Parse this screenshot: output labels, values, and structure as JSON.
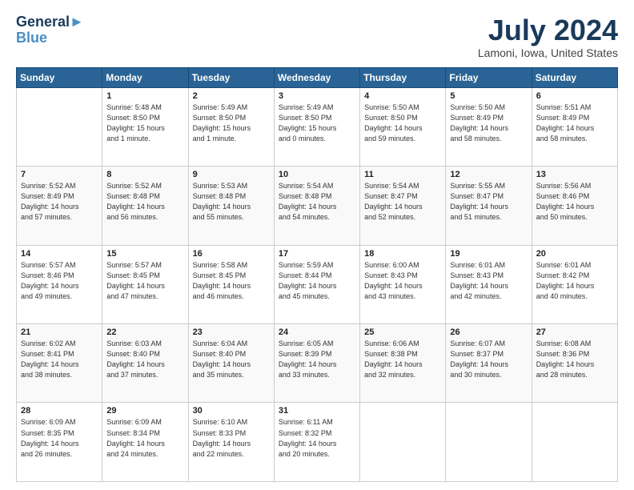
{
  "header": {
    "logo_line1": "General",
    "logo_line2": "Blue",
    "month": "July 2024",
    "location": "Lamoni, Iowa, United States"
  },
  "weekdays": [
    "Sunday",
    "Monday",
    "Tuesday",
    "Wednesday",
    "Thursday",
    "Friday",
    "Saturday"
  ],
  "weeks": [
    [
      {
        "day": "",
        "sunrise": "",
        "sunset": "",
        "daylight": ""
      },
      {
        "day": "1",
        "sunrise": "Sunrise: 5:48 AM",
        "sunset": "Sunset: 8:50 PM",
        "daylight": "Daylight: 15 hours and 1 minute."
      },
      {
        "day": "2",
        "sunrise": "Sunrise: 5:49 AM",
        "sunset": "Sunset: 8:50 PM",
        "daylight": "Daylight: 15 hours and 1 minute."
      },
      {
        "day": "3",
        "sunrise": "Sunrise: 5:49 AM",
        "sunset": "Sunset: 8:50 PM",
        "daylight": "Daylight: 15 hours and 0 minutes."
      },
      {
        "day": "4",
        "sunrise": "Sunrise: 5:50 AM",
        "sunset": "Sunset: 8:50 PM",
        "daylight": "Daylight: 14 hours and 59 minutes."
      },
      {
        "day": "5",
        "sunrise": "Sunrise: 5:50 AM",
        "sunset": "Sunset: 8:49 PM",
        "daylight": "Daylight: 14 hours and 58 minutes."
      },
      {
        "day": "6",
        "sunrise": "Sunrise: 5:51 AM",
        "sunset": "Sunset: 8:49 PM",
        "daylight": "Daylight: 14 hours and 58 minutes."
      }
    ],
    [
      {
        "day": "7",
        "sunrise": "Sunrise: 5:52 AM",
        "sunset": "Sunset: 8:49 PM",
        "daylight": "Daylight: 14 hours and 57 minutes."
      },
      {
        "day": "8",
        "sunrise": "Sunrise: 5:52 AM",
        "sunset": "Sunset: 8:48 PM",
        "daylight": "Daylight: 14 hours and 56 minutes."
      },
      {
        "day": "9",
        "sunrise": "Sunrise: 5:53 AM",
        "sunset": "Sunset: 8:48 PM",
        "daylight": "Daylight: 14 hours and 55 minutes."
      },
      {
        "day": "10",
        "sunrise": "Sunrise: 5:54 AM",
        "sunset": "Sunset: 8:48 PM",
        "daylight": "Daylight: 14 hours and 54 minutes."
      },
      {
        "day": "11",
        "sunrise": "Sunrise: 5:54 AM",
        "sunset": "Sunset: 8:47 PM",
        "daylight": "Daylight: 14 hours and 52 minutes."
      },
      {
        "day": "12",
        "sunrise": "Sunrise: 5:55 AM",
        "sunset": "Sunset: 8:47 PM",
        "daylight": "Daylight: 14 hours and 51 minutes."
      },
      {
        "day": "13",
        "sunrise": "Sunrise: 5:56 AM",
        "sunset": "Sunset: 8:46 PM",
        "daylight": "Daylight: 14 hours and 50 minutes."
      }
    ],
    [
      {
        "day": "14",
        "sunrise": "Sunrise: 5:57 AM",
        "sunset": "Sunset: 8:46 PM",
        "daylight": "Daylight: 14 hours and 49 minutes."
      },
      {
        "day": "15",
        "sunrise": "Sunrise: 5:57 AM",
        "sunset": "Sunset: 8:45 PM",
        "daylight": "Daylight: 14 hours and 47 minutes."
      },
      {
        "day": "16",
        "sunrise": "Sunrise: 5:58 AM",
        "sunset": "Sunset: 8:45 PM",
        "daylight": "Daylight: 14 hours and 46 minutes."
      },
      {
        "day": "17",
        "sunrise": "Sunrise: 5:59 AM",
        "sunset": "Sunset: 8:44 PM",
        "daylight": "Daylight: 14 hours and 45 minutes."
      },
      {
        "day": "18",
        "sunrise": "Sunrise: 6:00 AM",
        "sunset": "Sunset: 8:43 PM",
        "daylight": "Daylight: 14 hours and 43 minutes."
      },
      {
        "day": "19",
        "sunrise": "Sunrise: 6:01 AM",
        "sunset": "Sunset: 8:43 PM",
        "daylight": "Daylight: 14 hours and 42 minutes."
      },
      {
        "day": "20",
        "sunrise": "Sunrise: 6:01 AM",
        "sunset": "Sunset: 8:42 PM",
        "daylight": "Daylight: 14 hours and 40 minutes."
      }
    ],
    [
      {
        "day": "21",
        "sunrise": "Sunrise: 6:02 AM",
        "sunset": "Sunset: 8:41 PM",
        "daylight": "Daylight: 14 hours and 38 minutes."
      },
      {
        "day": "22",
        "sunrise": "Sunrise: 6:03 AM",
        "sunset": "Sunset: 8:40 PM",
        "daylight": "Daylight: 14 hours and 37 minutes."
      },
      {
        "day": "23",
        "sunrise": "Sunrise: 6:04 AM",
        "sunset": "Sunset: 8:40 PM",
        "daylight": "Daylight: 14 hours and 35 minutes."
      },
      {
        "day": "24",
        "sunrise": "Sunrise: 6:05 AM",
        "sunset": "Sunset: 8:39 PM",
        "daylight": "Daylight: 14 hours and 33 minutes."
      },
      {
        "day": "25",
        "sunrise": "Sunrise: 6:06 AM",
        "sunset": "Sunset: 8:38 PM",
        "daylight": "Daylight: 14 hours and 32 minutes."
      },
      {
        "day": "26",
        "sunrise": "Sunrise: 6:07 AM",
        "sunset": "Sunset: 8:37 PM",
        "daylight": "Daylight: 14 hours and 30 minutes."
      },
      {
        "day": "27",
        "sunrise": "Sunrise: 6:08 AM",
        "sunset": "Sunset: 8:36 PM",
        "daylight": "Daylight: 14 hours and 28 minutes."
      }
    ],
    [
      {
        "day": "28",
        "sunrise": "Sunrise: 6:09 AM",
        "sunset": "Sunset: 8:35 PM",
        "daylight": "Daylight: 14 hours and 26 minutes."
      },
      {
        "day": "29",
        "sunrise": "Sunrise: 6:09 AM",
        "sunset": "Sunset: 8:34 PM",
        "daylight": "Daylight: 14 hours and 24 minutes."
      },
      {
        "day": "30",
        "sunrise": "Sunrise: 6:10 AM",
        "sunset": "Sunset: 8:33 PM",
        "daylight": "Daylight: 14 hours and 22 minutes."
      },
      {
        "day": "31",
        "sunrise": "Sunrise: 6:11 AM",
        "sunset": "Sunset: 8:32 PM",
        "daylight": "Daylight: 14 hours and 20 minutes."
      },
      {
        "day": "",
        "sunrise": "",
        "sunset": "",
        "daylight": ""
      },
      {
        "day": "",
        "sunrise": "",
        "sunset": "",
        "daylight": ""
      },
      {
        "day": "",
        "sunrise": "",
        "sunset": "",
        "daylight": ""
      }
    ]
  ]
}
